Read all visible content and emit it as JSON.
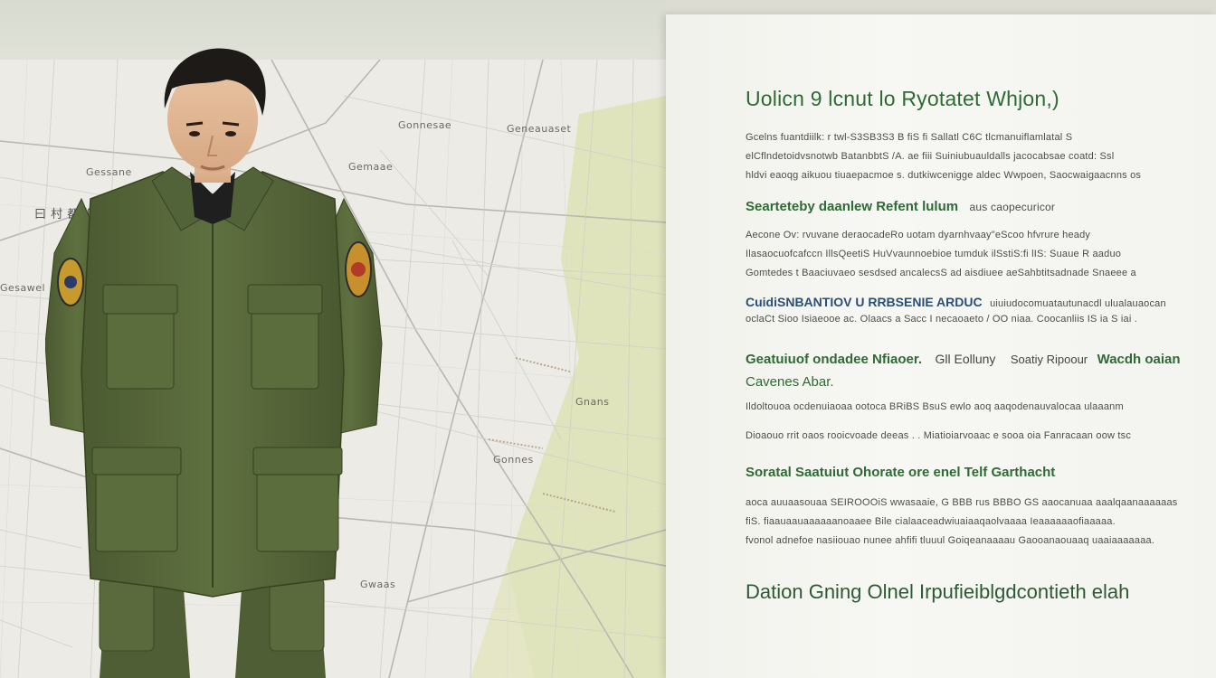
{
  "colors": {
    "heading_green": "#2e6b34",
    "subhead_blue": "#2b4f73",
    "uniform_olive": "#56673a",
    "map_park_green": "#dfe3b8"
  },
  "map": {
    "labels": [
      "曰 村 都 鄉",
      "Gessane",
      "Gesawel",
      "Gonnesae",
      "Geneauaset",
      "Gemaae",
      "Gonnes",
      "Gwaas",
      "Gnans"
    ]
  },
  "panel": {
    "heading": "Uolicn 9 lcnut lo Ryotatet Whjon,)",
    "intro_lines": [
      "Gcelns fuantdiilk: r twl-S3SB3S3 B fiS fi Sallatl C6C tlcmanuiflamlatal S",
      "elCflndetoidvsnotwb BatanbbtS /A. ae fiii Suiniubuauldalls jacocabsae coatd: Ssl",
      "hldvi eaoqg aikuou tiuaepacmoe s. dutkiwcenigge aldec Wwpoen, Saocwaigaacnns os"
    ],
    "section1": {
      "heading": "Searteteby daanlew Refent lulum",
      "heading_tail": "aus caopecuricor",
      "lines": [
        "Aecone Ov: rvuvane deraocadeRo uotam dyarnhvaay\"eScoo hfvrure heady",
        "Ilasaocuofcafccn IllsQeetiS HuVvaunnoebioe tumduk ilSstiS:fi lIS: Suaue R aaduo",
        "Gomtedes t Baaciuvaeo sesdsed ancalecsS ad aisdiuee aeSahbtitsadnade Snaeee a"
      ]
    },
    "section2": {
      "heading": "CuidiSNBANTIOV U RRBSENIE ARDUC",
      "heading_tail": "uiuiudocomuatautunacdl ulualauaocan",
      "line": "oclaCt Sioo Isiaeooe ac. Olaacs a Sacc I necaoaeto / OO niaa. Coocanliis IS ia S iai ."
    },
    "section3": {
      "heading": "Geatuiuof ondadee Nfiaoer.",
      "heading_mid": "Gll Eolluny",
      "heading_tail": "Soatiy Ripoour",
      "heading_end": "Wacdh oaian",
      "subheading": "Cavenes Abar.",
      "lines": [
        "Ildoltouoa ocdenuiaoaa ootoca BRiBS BsuS ewlo aoq aaqodenauvalocaa ulaaanm",
        "Dioaouo rrit oaos rooicvoade deeas . . Miatioiarvoaac e sooa oia Fanracaan oow tsc"
      ]
    },
    "section4": {
      "heading": "Soratal Saatuiut Ohorate ore enel Telf Garthacht",
      "lines": [
        "aoca auuaasouaa SEIROOOiS wwasaaie, G BBB rus BBBO GS aaocanuaa aaalqaanaaaaaas",
        "fiS. fiaauaauaaaaaanoaaee Bile cialaaceadwiuaiaaqaolvaaaa Ieaaaaaaofiaaaaa.",
        "fvonol adnefoe nasiiouao nunee ahfifi tluuul Goiqeanaaaau Gaooanaouaaq uaaiaaaaaaa."
      ]
    },
    "footer": "Dation Gning Olnel Irpufieiblgdcontieth elah"
  }
}
